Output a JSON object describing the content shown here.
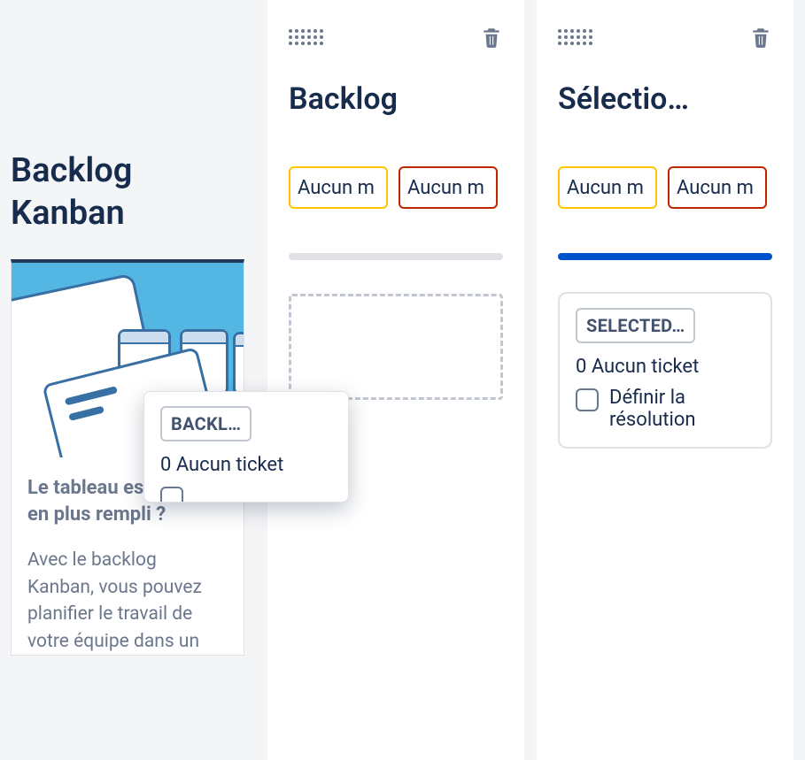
{
  "sidebar": {
    "title": "Backlog Kanban",
    "promo": {
      "heading": "Le tableau est de plus en plus rempli ?",
      "body": "Avec le backlog Kanban, vous pouvez planifier le travail de votre équipe dans un"
    }
  },
  "columns": [
    {
      "id": "backlog",
      "title": "Backlog",
      "lozenges": [
        "Aucun m",
        "Aucun m"
      ],
      "progress_pct": 0,
      "has_dropzone": true,
      "card": null
    },
    {
      "id": "selected",
      "title": "Sélectio…",
      "lozenges": [
        "Aucun m",
        "Aucun m"
      ],
      "progress_pct": 100,
      "has_dropzone": false,
      "card": {
        "badge": "SELECTED…",
        "sub": "0 Aucun ticket",
        "check_label": "Définir la résolution"
      }
    }
  ],
  "floating_card": {
    "badge": "BACKL…",
    "sub": "0 Aucun ticket"
  }
}
